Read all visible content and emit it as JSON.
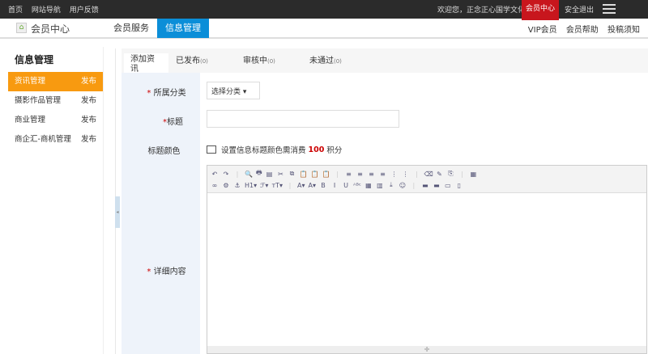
{
  "topbar": {
    "links": [
      "首页",
      "网站导航",
      "用户反馈"
    ],
    "welcome": "欢迎您，正念正心国学文化",
    "member_center": "会员中心",
    "logout": "安全退出"
  },
  "header": {
    "brand": "会员中心",
    "nav": [
      "会员服务",
      "信息管理"
    ],
    "links": [
      "VIP会员",
      "会员帮助",
      "投稿须知"
    ]
  },
  "sidebar": {
    "title": "信息管理",
    "items": [
      {
        "label": "资讯管理",
        "action": "发布"
      },
      {
        "label": "摄影作品管理",
        "action": "发布"
      },
      {
        "label": "商业管理",
        "action": "发布"
      },
      {
        "label": "商企汇-商机管理",
        "action": "发布"
      }
    ]
  },
  "tabs": [
    {
      "label": "添加资讯"
    },
    {
      "label": "已发布",
      "count": "(0)"
    },
    {
      "label": "审核中",
      "count": "(0)"
    },
    {
      "label": "未通过",
      "count": "(0)"
    }
  ],
  "form": {
    "category_label": "所属分类",
    "category_value": "选择分类 ▾",
    "title_label": "标题",
    "color_label": "标题颜色",
    "color_text": "设置信息标题颜色需消费",
    "color_cost": "100",
    "color_unit": "积分",
    "content_label": "详细内容"
  },
  "toolbar": {
    "row1": [
      "↶",
      "↷",
      "|",
      "🔍",
      "🖶",
      "▤",
      "✂",
      "⧉",
      "📋",
      "📋",
      "📋",
      "|",
      "≡",
      "≡",
      "≡",
      "≡",
      "⋮",
      "⋮",
      "|",
      "⌫",
      "✎",
      "⎘",
      "|",
      "▦"
    ],
    "row2": [
      "∞",
      "⚙",
      "⚓",
      "H1▾",
      "ℱ▾",
      "ᴛT▾",
      "|",
      "A▾",
      "A▾",
      "B",
      "I",
      "U",
      "ᴬᴮᶜ",
      "▦",
      "▥",
      "⤓",
      "☺",
      "|",
      "▬",
      "▬",
      "▭",
      "▯"
    ]
  }
}
